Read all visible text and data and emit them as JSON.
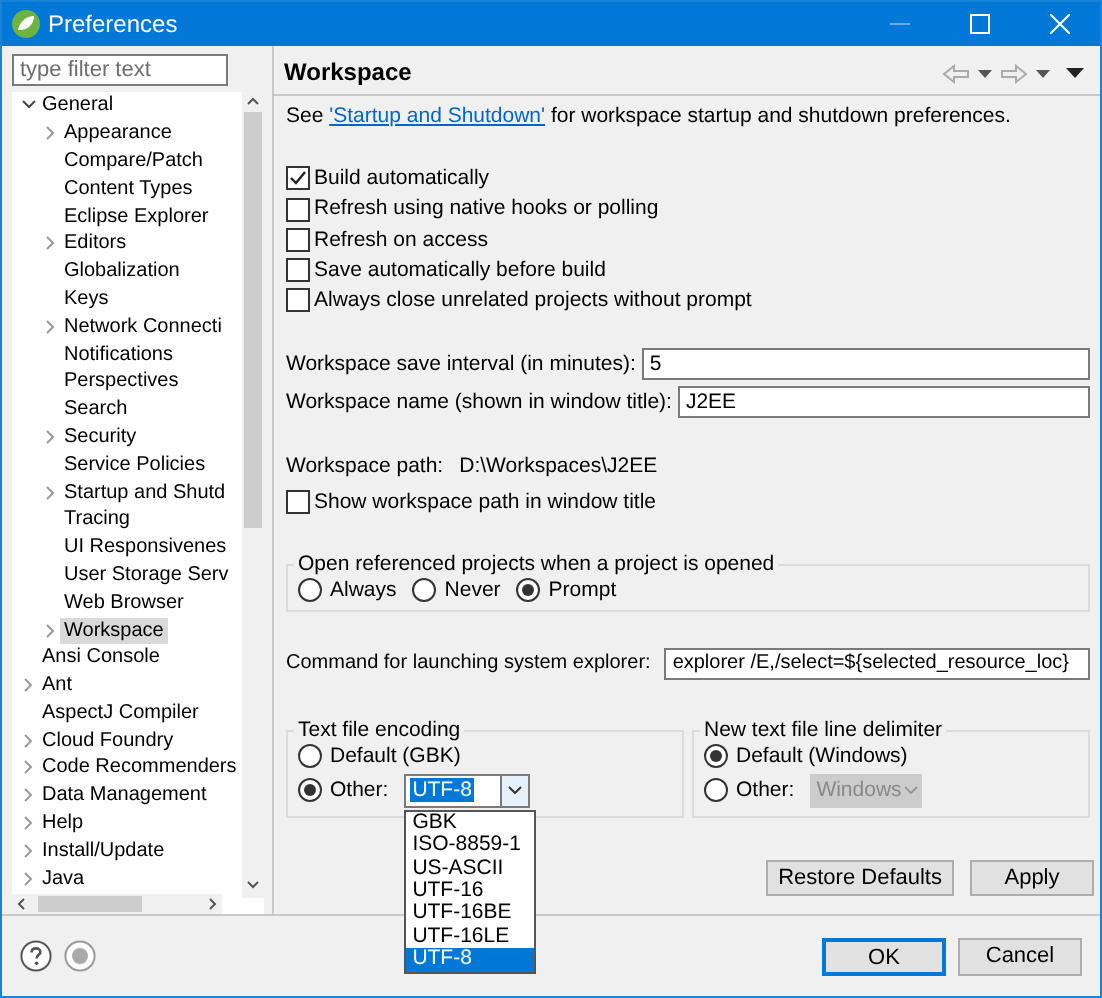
{
  "window": {
    "title": "Preferences"
  },
  "filter": {
    "placeholder": "type filter text"
  },
  "tree": [
    {
      "label": "General",
      "expanded": true,
      "selected": false,
      "children": [
        {
          "label": "Appearance",
          "expanded": false,
          "selected": false
        },
        {
          "label": "Compare/Patch",
          "selected": false
        },
        {
          "label": "Content Types",
          "selected": false
        },
        {
          "label": "Eclipse Explorer",
          "selected": false
        },
        {
          "label": "Editors",
          "expanded": false,
          "selected": false
        },
        {
          "label": "Globalization",
          "selected": false
        },
        {
          "label": "Keys",
          "selected": false
        },
        {
          "label": "Network Connecti",
          "expanded": false,
          "selected": false
        },
        {
          "label": "Notifications",
          "selected": false
        },
        {
          "label": "Perspectives",
          "selected": false
        },
        {
          "label": "Search",
          "selected": false
        },
        {
          "label": "Security",
          "expanded": false,
          "selected": false
        },
        {
          "label": "Service Policies",
          "selected": false
        },
        {
          "label": "Startup and Shutd",
          "expanded": false,
          "selected": false
        },
        {
          "label": "Tracing",
          "selected": false
        },
        {
          "label": "UI Responsivenes",
          "selected": false
        },
        {
          "label": "User Storage Serv",
          "selected": false
        },
        {
          "label": "Web Browser",
          "selected": false
        },
        {
          "label": "Workspace",
          "expanded": false,
          "selected": true
        }
      ]
    },
    {
      "label": "Ansi Console",
      "selected": false
    },
    {
      "label": "Ant",
      "expanded": false,
      "selected": false
    },
    {
      "label": "AspectJ Compiler",
      "selected": false
    },
    {
      "label": "Cloud Foundry",
      "expanded": false,
      "selected": false
    },
    {
      "label": "Code Recommenders",
      "expanded": false,
      "selected": false
    },
    {
      "label": "Data Management",
      "expanded": false,
      "selected": false
    },
    {
      "label": "Help",
      "expanded": false,
      "selected": false
    },
    {
      "label": "Install/Update",
      "expanded": false,
      "selected": false
    },
    {
      "label": "Java",
      "expanded": false,
      "selected": false
    }
  ],
  "page": {
    "title": "Workspace",
    "intro": {
      "before": "See ",
      "link": "'Startup and Shutdown'",
      "after": " for workspace startup and shutdown preferences."
    },
    "checkboxes": [
      {
        "label": "Build automatically",
        "checked": true
      },
      {
        "label": "Refresh using native hooks or polling",
        "checked": false
      },
      {
        "label": "Refresh on access",
        "checked": false
      },
      {
        "label": "Save automatically before build",
        "checked": false
      },
      {
        "label": "Always close unrelated projects without prompt",
        "checked": false
      }
    ],
    "fields": [
      {
        "label": "Workspace save interval (in minutes):",
        "value": "5"
      },
      {
        "label": "Workspace name (shown in window title):",
        "value": "J2EE"
      }
    ],
    "path": {
      "label": "Workspace path:",
      "value": "D:\\Workspaces\\J2EE"
    },
    "show_path": {
      "label": "Show workspace path in window title",
      "checked": false
    },
    "open_referenced": {
      "title": "Open referenced projects when a project is opened",
      "options": [
        {
          "label": "Always",
          "selected": false
        },
        {
          "label": "Never",
          "selected": false
        },
        {
          "label": "Prompt",
          "selected": true
        }
      ]
    },
    "command": {
      "label": "Command for launching system explorer:",
      "value": "explorer /E,/select=${selected_resource_loc}"
    },
    "encoding": {
      "title": "Text file encoding",
      "options": [
        {
          "label": "Default (GBK)",
          "selected": false
        },
        {
          "label": "Other:",
          "selected": true
        }
      ],
      "combo": {
        "value": "UTF-8",
        "disabled": false
      },
      "dropdown": [
        {
          "label": "GBK",
          "selected": false
        },
        {
          "label": "ISO-8859-1",
          "selected": false
        },
        {
          "label": "US-ASCII",
          "selected": false
        },
        {
          "label": "UTF-16",
          "selected": false
        },
        {
          "label": "UTF-16BE",
          "selected": false
        },
        {
          "label": "UTF-16LE",
          "selected": false
        },
        {
          "label": "UTF-8",
          "selected": true
        }
      ]
    },
    "delimiter": {
      "title": "New text file line delimiter",
      "options": [
        {
          "label": "Default (Windows)",
          "selected": true
        },
        {
          "label": "Other:",
          "selected": false
        }
      ],
      "combo": {
        "value": "Windows",
        "disabled": true
      }
    },
    "buttons": [
      {
        "label": "Restore Defaults"
      },
      {
        "label": "Apply"
      }
    ]
  },
  "dialog_buttons": [
    {
      "label": "OK",
      "focused": true
    },
    {
      "label": "Cancel",
      "focused": false
    }
  ]
}
